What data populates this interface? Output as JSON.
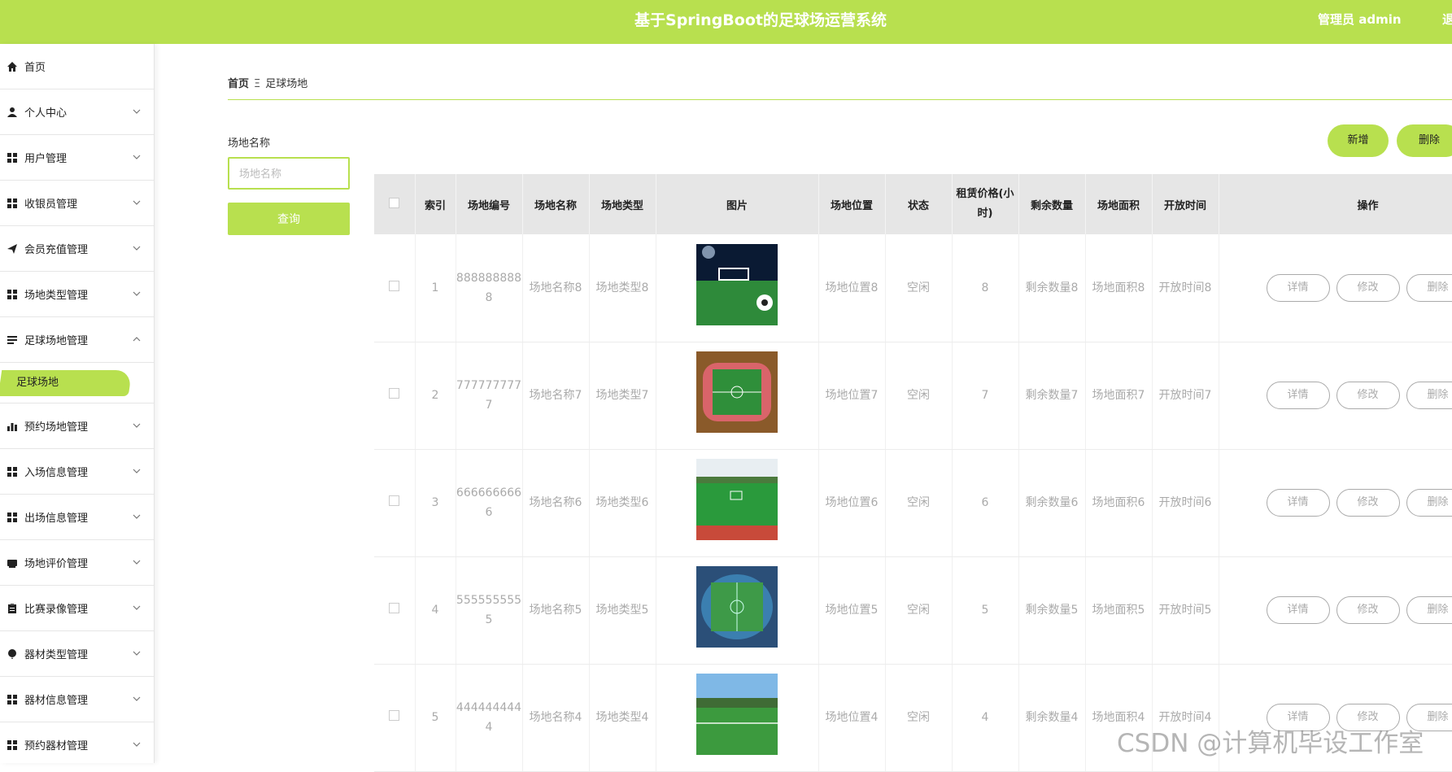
{
  "header": {
    "title": "基于SpringBoot的足球场运营系统",
    "user": "管理员 admin",
    "logout": "退出"
  },
  "sidebar": {
    "items": [
      {
        "label": "首页",
        "icon": "home-icon"
      },
      {
        "label": "个人中心",
        "icon": "user-icon"
      },
      {
        "label": "用户管理",
        "icon": "grid-icon"
      },
      {
        "label": "收银员管理",
        "icon": "grid-icon"
      },
      {
        "label": "会员充值管理",
        "icon": "send-icon"
      },
      {
        "label": "场地类型管理",
        "icon": "grid-icon"
      },
      {
        "label": "足球场地管理",
        "icon": "list-icon"
      },
      {
        "label": "预约场地管理",
        "icon": "bar-chart-icon"
      },
      {
        "label": "入场信息管理",
        "icon": "grid-icon"
      },
      {
        "label": "出场信息管理",
        "icon": "grid-icon"
      },
      {
        "label": "场地评价管理",
        "icon": "keyboard-icon"
      },
      {
        "label": "比赛录像管理",
        "icon": "clipboard-icon"
      },
      {
        "label": "器材类型管理",
        "icon": "balloon-icon"
      },
      {
        "label": "器材信息管理",
        "icon": "grid-icon"
      },
      {
        "label": "预约器材管理",
        "icon": "grid-icon"
      }
    ],
    "active_sub": "足球场地"
  },
  "breadcrumb": {
    "home": "首页",
    "separator": "Ξ",
    "current": "足球场地"
  },
  "filter": {
    "label": "场地名称",
    "placeholder": "场地名称",
    "query_button": "查询"
  },
  "actions": {
    "add": "新增",
    "delete": "删除"
  },
  "table": {
    "headers": [
      "索引",
      "场地编号",
      "场地名称",
      "场地类型",
      "图片",
      "场地位置",
      "状态",
      "租赁价格(小时)",
      "剩余数量",
      "场地面积",
      "开放时间",
      "操作"
    ],
    "rows": [
      {
        "index": "1",
        "code": "8888888888",
        "name": "场地名称8",
        "type": "场地类型8",
        "location": "场地位置8",
        "status": "空闲",
        "price": "8",
        "remain": "剩余数量8",
        "area": "场地面积8",
        "open": "开放时间8"
      },
      {
        "index": "2",
        "code": "7777777777",
        "name": "场地名称7",
        "type": "场地类型7",
        "location": "场地位置7",
        "status": "空闲",
        "price": "7",
        "remain": "剩余数量7",
        "area": "场地面积7",
        "open": "开放时间7"
      },
      {
        "index": "3",
        "code": "6666666666",
        "name": "场地名称6",
        "type": "场地类型6",
        "location": "场地位置6",
        "status": "空闲",
        "price": "6",
        "remain": "剩余数量6",
        "area": "场地面积6",
        "open": "开放时间6"
      },
      {
        "index": "4",
        "code": "5555555555",
        "name": "场地名称5",
        "type": "场地类型5",
        "location": "场地位置5",
        "status": "空闲",
        "price": "5",
        "remain": "剩余数量5",
        "area": "场地面积5",
        "open": "开放时间5"
      },
      {
        "index": "5",
        "code": "4444444444",
        "name": "场地名称4",
        "type": "场地类型4",
        "location": "场地位置4",
        "status": "空闲",
        "price": "4",
        "remain": "剩余数量4",
        "area": "场地面积4",
        "open": "开放时间4"
      }
    ],
    "row_buttons": {
      "detail": "详情",
      "edit": "修改",
      "delete": "删除"
    }
  },
  "watermark": "CSDN @计算机毕设工作室",
  "colors": {
    "accent": "#b8e04f",
    "header_bg": "#e6e6e6"
  }
}
